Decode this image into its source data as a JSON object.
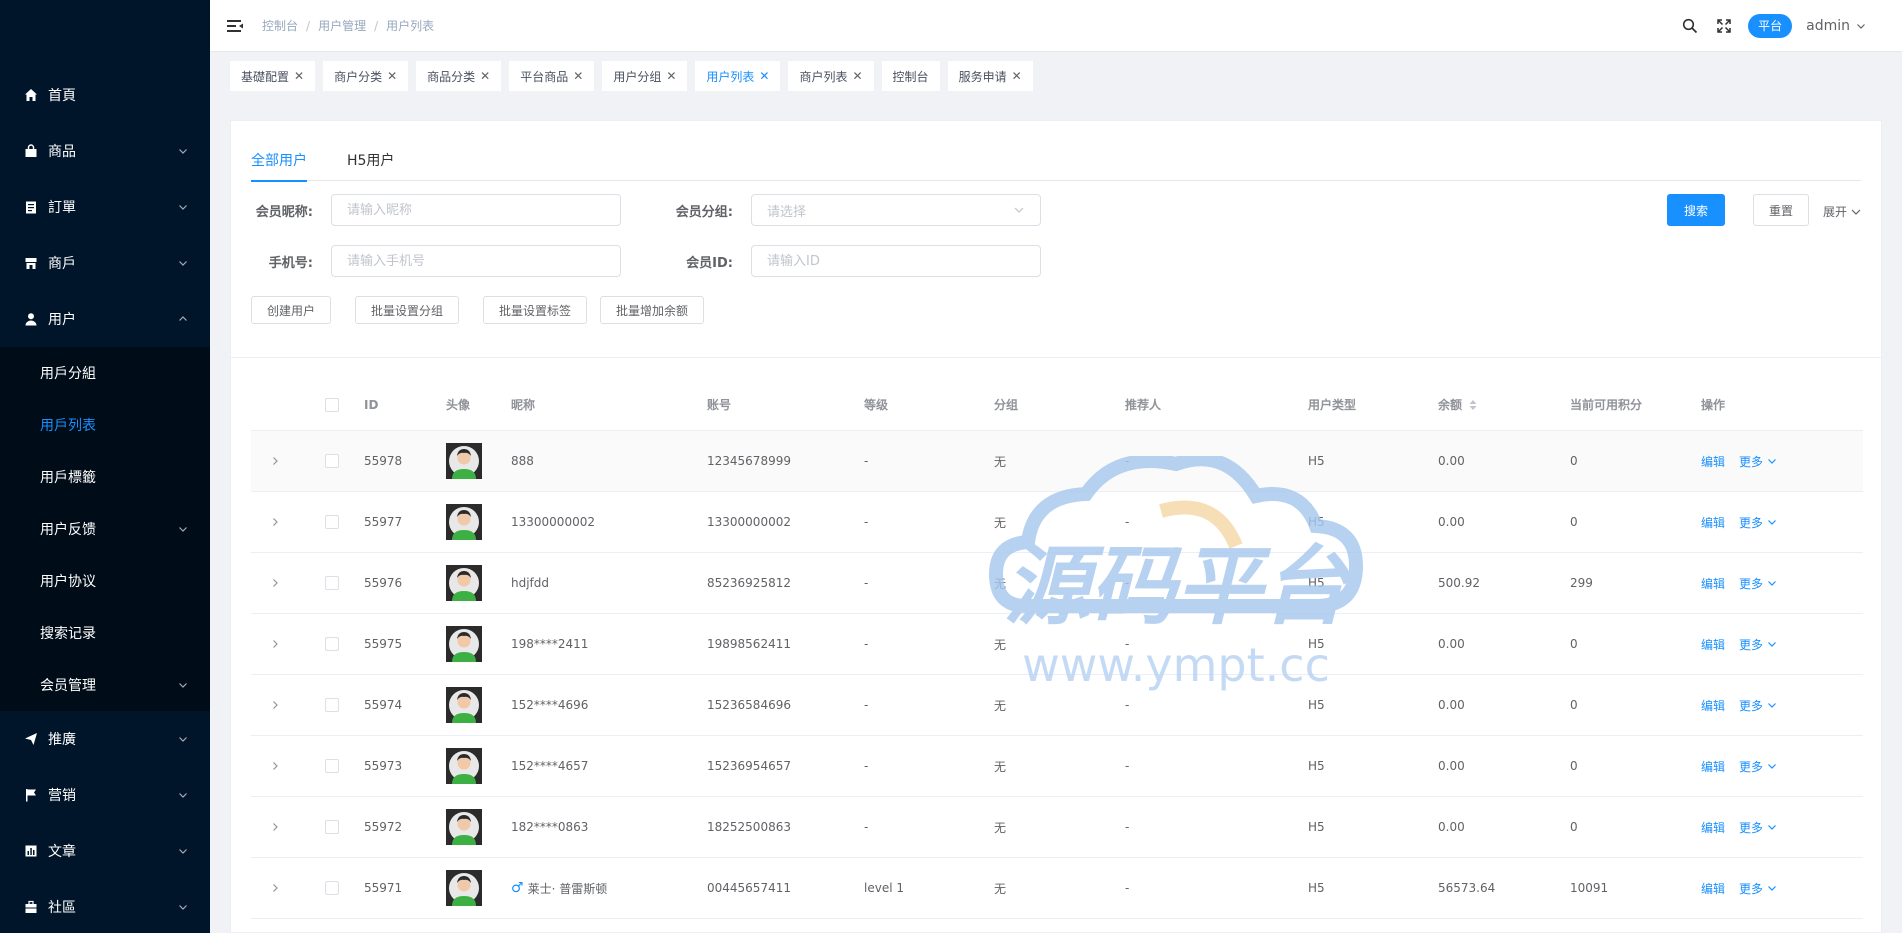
{
  "sidebar": {
    "items": [
      {
        "label": "首頁",
        "icon": "home-icon",
        "arrow": false
      },
      {
        "label": "商品",
        "icon": "bag-icon",
        "arrow": true
      },
      {
        "label": "訂單",
        "icon": "clipboard-icon",
        "arrow": true
      },
      {
        "label": "商戶",
        "icon": "shop-icon",
        "arrow": true
      },
      {
        "label": "用户",
        "icon": "user-icon",
        "arrow": true,
        "expanded": true
      }
    ],
    "sub_items": [
      {
        "label": "用戶分組",
        "active": false,
        "arrow": false
      },
      {
        "label": "用戶列表",
        "active": true,
        "arrow": false
      },
      {
        "label": "用戶標籤",
        "active": false,
        "arrow": false
      },
      {
        "label": "用户反馈",
        "active": false,
        "arrow": true
      },
      {
        "label": "用户协议",
        "active": false,
        "arrow": false
      },
      {
        "label": "搜索记录",
        "active": false,
        "arrow": false
      },
      {
        "label": "会员管理",
        "active": false,
        "arrow": true
      }
    ],
    "bottom_items": [
      {
        "label": "推廣",
        "icon": "send-icon"
      },
      {
        "label": "营销",
        "icon": "flag-icon"
      },
      {
        "label": "文章",
        "icon": "chart-icon"
      },
      {
        "label": "社區",
        "icon": "briefcase-icon"
      }
    ]
  },
  "header": {
    "breadcrumb": [
      "控制台",
      "用户管理",
      "用户列表"
    ],
    "platform": "平台",
    "user": "admin"
  },
  "tags": [
    {
      "label": "基礎配置",
      "closable": true,
      "active": false
    },
    {
      "label": "商户分类",
      "closable": true,
      "active": false
    },
    {
      "label": "商品分类",
      "closable": true,
      "active": false
    },
    {
      "label": "平台商品",
      "closable": true,
      "active": false
    },
    {
      "label": "用户分组",
      "closable": true,
      "active": false
    },
    {
      "label": "用户列表",
      "closable": true,
      "active": true
    },
    {
      "label": "商户列表",
      "closable": true,
      "active": false
    },
    {
      "label": "控制台",
      "closable": false,
      "active": false
    },
    {
      "label": "服务申请",
      "closable": true,
      "active": false
    }
  ],
  "tabs": [
    "全部用户",
    "H5用户"
  ],
  "filters": {
    "nickname_label": "会员昵称:",
    "nickname_placeholder": "请输入昵称",
    "group_label": "会员分组:",
    "group_placeholder": "请选择",
    "phone_label": "手机号:",
    "phone_placeholder": "请输入手机号",
    "id_label": "会员ID:",
    "id_placeholder": "请输入ID",
    "search_label": "搜索",
    "reset_label": "重置",
    "expand_label": "展开"
  },
  "actions": [
    "创建用户",
    "批量设置分组",
    "批量设置标签",
    "批量增加余额"
  ],
  "table": {
    "columns": [
      "ID",
      "头像",
      "昵称",
      "账号",
      "等级",
      "分组",
      "推荐人",
      "用户类型",
      "余额",
      "当前可用积分",
      "操作"
    ],
    "edit_label": "编辑",
    "more_label": "更多",
    "rows": [
      {
        "id": "55978",
        "nickname": "888",
        "account": "12345678999",
        "level": "-",
        "group": "无",
        "referrer": "-",
        "type": "H5",
        "balance": "0.00",
        "points": "0",
        "male": false
      },
      {
        "id": "55977",
        "nickname": "13300000002",
        "account": "13300000002",
        "level": "-",
        "group": "无",
        "referrer": "-",
        "type": "H5",
        "balance": "0.00",
        "points": "0",
        "male": false
      },
      {
        "id": "55976",
        "nickname": "hdjfdd",
        "account": "85236925812",
        "level": "-",
        "group": "无",
        "referrer": "-",
        "type": "H5",
        "balance": "500.92",
        "points": "299",
        "male": false
      },
      {
        "id": "55975",
        "nickname": "198****2411",
        "account": "19898562411",
        "level": "-",
        "group": "无",
        "referrer": "-",
        "type": "H5",
        "balance": "0.00",
        "points": "0",
        "male": false
      },
      {
        "id": "55974",
        "nickname": "152****4696",
        "account": "15236584696",
        "level": "-",
        "group": "无",
        "referrer": "-",
        "type": "H5",
        "balance": "0.00",
        "points": "0",
        "male": false
      },
      {
        "id": "55973",
        "nickname": "152****4657",
        "account": "15236954657",
        "level": "-",
        "group": "无",
        "referrer": "-",
        "type": "H5",
        "balance": "0.00",
        "points": "0",
        "male": false
      },
      {
        "id": "55972",
        "nickname": "182****0863",
        "account": "18252500863",
        "level": "-",
        "group": "无",
        "referrer": "-",
        "type": "H5",
        "balance": "0.00",
        "points": "0",
        "male": false
      },
      {
        "id": "55971",
        "nickname": "莱士· 普雷斯顿",
        "account": "00445657411",
        "level": "level 1",
        "group": "无",
        "referrer": "-",
        "type": "H5",
        "balance": "56573.64",
        "points": "10091",
        "male": true
      }
    ]
  },
  "watermark": {
    "text": "源码平台",
    "url": "www.ympt.cc"
  },
  "colors": {
    "primary": "#1890ff",
    "sidebar_bg": "#001529",
    "submenu_bg": "#000c17"
  }
}
